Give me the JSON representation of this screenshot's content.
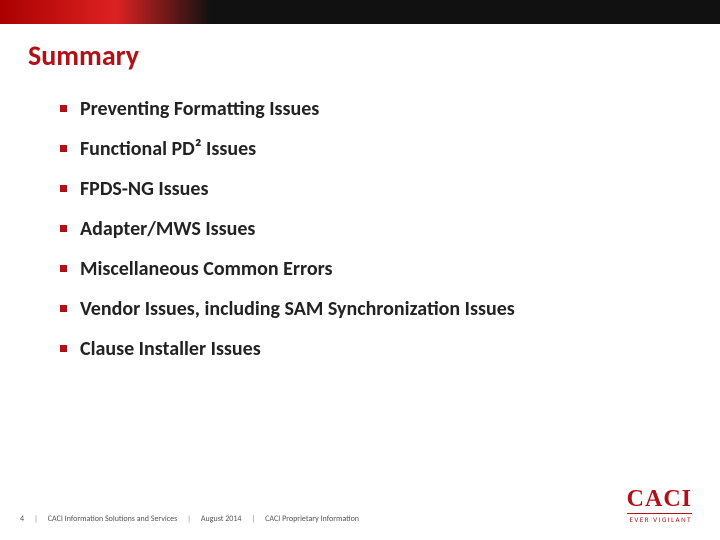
{
  "title": "Summary",
  "bullets": [
    "Preventing Formatting Issues",
    "Functional PD² Issues",
    "FPDS-NG Issues",
    "Adapter/MWS Issues",
    "Miscellaneous Common Errors",
    "Vendor Issues, including SAM Synchronization Issues",
    "Clause Installer Issues"
  ],
  "footer": {
    "page": "4",
    "org": "CACI Information Solutions and Services",
    "date": "August 2014",
    "rights": "CACI Proprietary Information"
  },
  "logo": {
    "brand": "CACI",
    "tagline": "EVER VIGILANT"
  }
}
